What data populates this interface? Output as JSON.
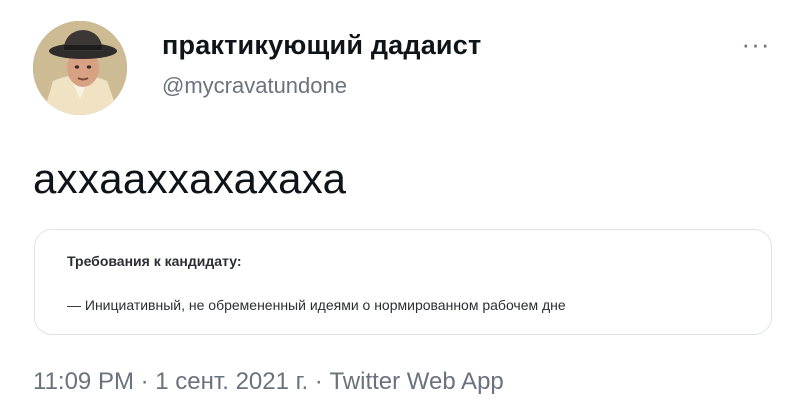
{
  "author": {
    "display_name": "практикующий дадаист",
    "username": "@mycravatundone",
    "avatar_icon": "man-in-hat-avatar"
  },
  "more_icon": "ellipsis-icon",
  "more_label": "···",
  "tweet": {
    "text": "ахxаахxахахаха",
    "quote": {
      "heading": "Требования к кандидату:",
      "line": "— Инициативный, не обремененный идеями о нормированном рабочем дне"
    }
  },
  "meta": {
    "time": "11:09 PM",
    "sep1": " · ",
    "date": "1 сент. 2021 г.",
    "sep2": " · ",
    "source": "Twitter Web App"
  }
}
